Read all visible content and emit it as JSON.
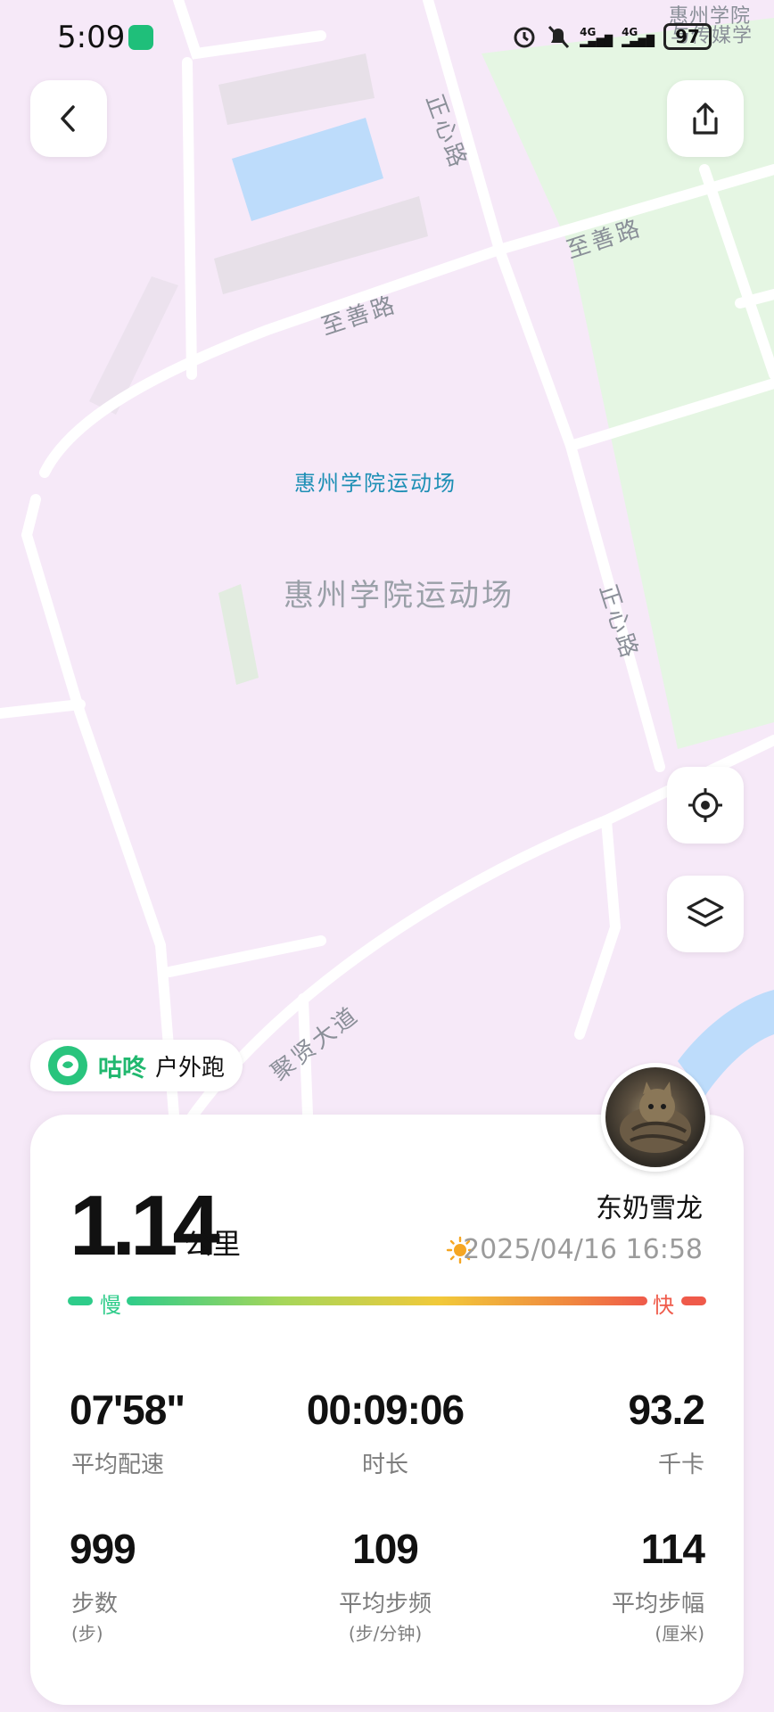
{
  "status_bar": {
    "time": "5:09",
    "network_1": "4G",
    "network_2": "4G",
    "battery": "97"
  },
  "map": {
    "poi_label": "惠州学院运动场",
    "area_label": "惠州学院运动场",
    "road_labels": [
      "正心路",
      "至善路",
      "至善路",
      "正心路",
      "聚贤大道"
    ],
    "corner_label_1": "惠州学院",
    "corner_label_2": "与传媒学",
    "colors": {
      "campus": "#f6e9f8",
      "green": "#e5f6e3",
      "water": "#bddcfb",
      "road": "#ffffff"
    }
  },
  "chip": {
    "brand": "咕咚",
    "activity": "户外跑"
  },
  "summary": {
    "distance": "1.14",
    "distance_unit": "公里",
    "username": "东奶雪龙",
    "datetime": "2025/04/16 16:58",
    "pace_slow": "慢",
    "pace_fast": "快",
    "weather_icon": "sun-icon"
  },
  "stats": [
    {
      "value": "07'58\"",
      "label": "平均配速",
      "sub": ""
    },
    {
      "value": "00:09:06",
      "label": "时长",
      "sub": ""
    },
    {
      "value": "93.2",
      "label": "千卡",
      "sub": ""
    },
    {
      "value": "999",
      "label": "步数",
      "sub": "(步)"
    },
    {
      "value": "109",
      "label": "平均步频",
      "sub": "(步/分钟)"
    },
    {
      "value": "114",
      "label": "平均步幅",
      "sub": "(厘米)"
    }
  ],
  "colors": {
    "accent": "#21b86f",
    "slow": "#2ecc8a",
    "fast": "#ef5a4a"
  }
}
